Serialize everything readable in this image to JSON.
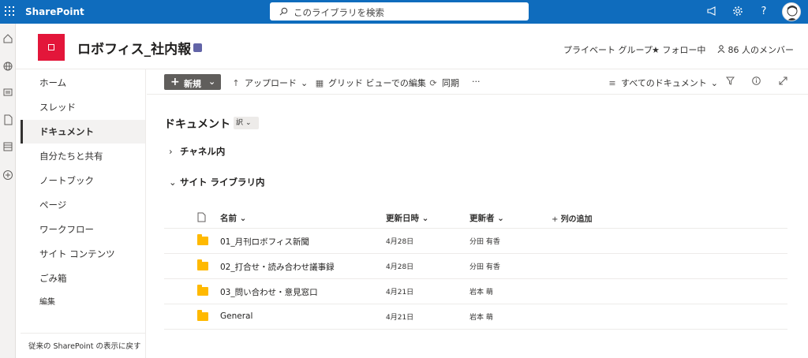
{
  "suite": {
    "app_name": "SharePoint",
    "search_placeholder": "このライブラリを検索",
    "icons": [
      "megaphone-icon",
      "gear-icon",
      "help-icon"
    ],
    "help_label": "?"
  },
  "site": {
    "title": "ロボフィス_社内報",
    "privacy": "プライベート グループ",
    "follow": "フォロー中",
    "members": "86 人のメンバー",
    "logo_color": "#e3163a"
  },
  "nav": {
    "items": [
      {
        "label": "ホーム"
      },
      {
        "label": "スレッド"
      },
      {
        "label": "ドキュメント"
      },
      {
        "label": "自分たちと共有"
      },
      {
        "label": "ノートブック"
      },
      {
        "label": "ページ"
      },
      {
        "label": "ワークフロー"
      },
      {
        "label": "サイト コンテンツ"
      },
      {
        "label": "ごみ箱"
      },
      {
        "label": "編集"
      }
    ],
    "selected_index": 2,
    "footer": "従来の SharePoint の表示に戻す"
  },
  "command_bar": {
    "new_label": "新規",
    "upload_label": "アップロード",
    "grid_edit_label": "グリッド ビューでの編集",
    "sync_label": "同期",
    "more_label": "···",
    "view_label": "すべてのドキュメント"
  },
  "library": {
    "title": "ドキュメント",
    "view_badge": "訳",
    "groups": [
      {
        "label": "チャネル内",
        "expanded": false
      },
      {
        "label": "サイト ライブラリ内",
        "expanded": true
      }
    ],
    "columns": {
      "name": "名前",
      "modified": "更新日時",
      "modified_by": "更新者",
      "add_column": "列の追加"
    },
    "rows": [
      {
        "name": "01_月刊ロボフィス新聞",
        "modified": "4月28日",
        "modified_by": "分田 有香"
      },
      {
        "name": "02_打合せ・読み合わせ議事録",
        "modified": "4月28日",
        "modified_by": "分田 有香"
      },
      {
        "name": "03_問い合わせ・意見窓口",
        "modified": "4月21日",
        "modified_by": "岩本 萌"
      },
      {
        "name": "General",
        "modified": "4月21日",
        "modified_by": "岩本 萌"
      }
    ]
  },
  "colors": {
    "suite_bar": "#0f6cbd",
    "folder": "#ffb900"
  }
}
